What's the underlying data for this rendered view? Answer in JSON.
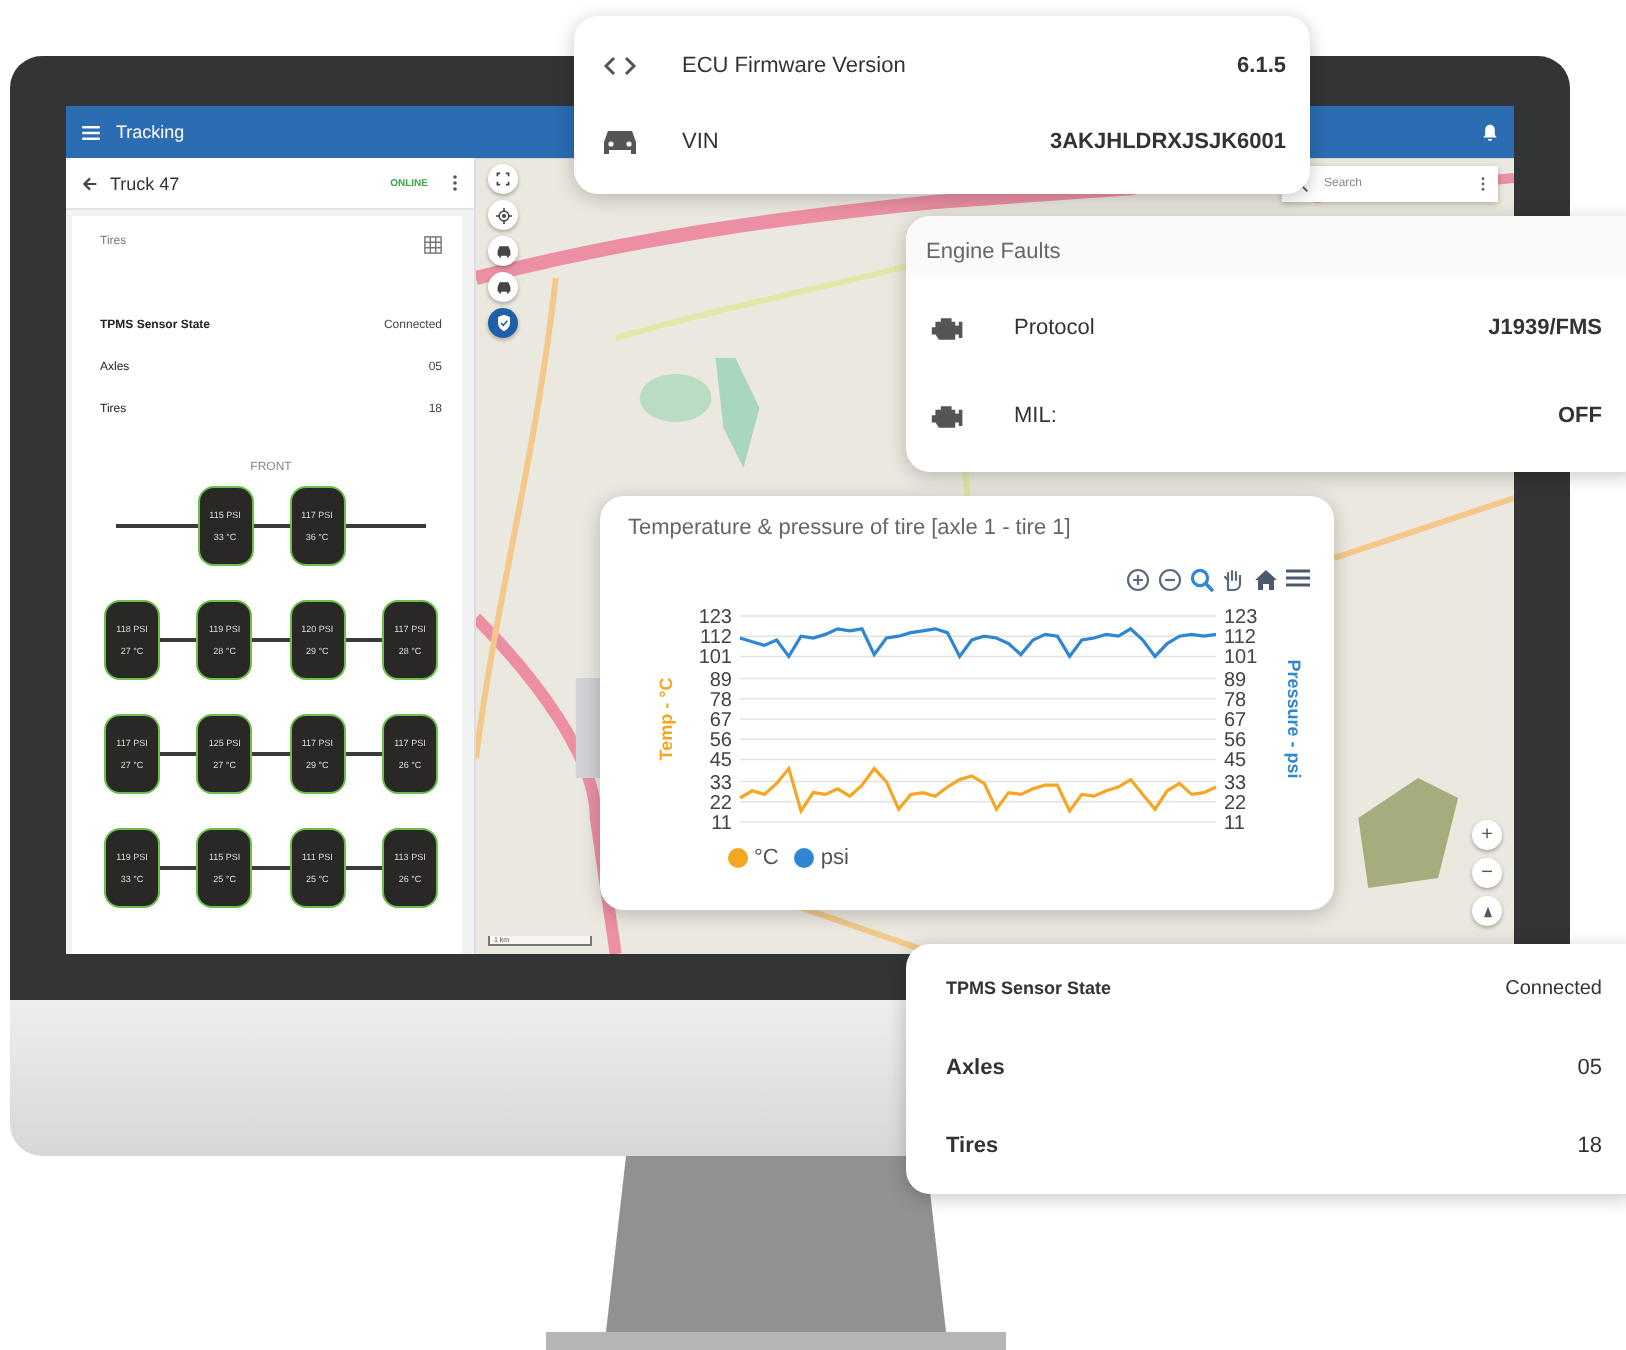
{
  "app_header": {
    "title": "Tracking"
  },
  "vehicle_panel": {
    "title": "Truck 47",
    "status": "ONLINE",
    "section_title": "Tires",
    "details": [
      {
        "label": "TPMS Sensor State",
        "value": "Connected"
      },
      {
        "label": "Axles",
        "value": "05"
      },
      {
        "label": "Tires",
        "value": "18"
      }
    ],
    "axle_label": "FRONT",
    "axles": [
      {
        "tires": [
          {
            "pressure": "115 PSI",
            "temperature": "33 °C"
          },
          {
            "pressure": "117 PSI",
            "temperature": "36 °C"
          }
        ]
      },
      {
        "tires": [
          {
            "pressure": "118 PSI",
            "temperature": "27 °C"
          },
          {
            "pressure": "119 PSI",
            "temperature": "28 °C"
          },
          {
            "pressure": "120 PSI",
            "temperature": "29 °C"
          },
          {
            "pressure": "117 PSI",
            "temperature": "28 °C"
          }
        ]
      },
      {
        "tires": [
          {
            "pressure": "117 PSI",
            "temperature": "27 °C"
          },
          {
            "pressure": "125 PSI",
            "temperature": "27 °C"
          },
          {
            "pressure": "117 PSI",
            "temperature": "29 °C"
          },
          {
            "pressure": "117 PSI",
            "temperature": "26 °C"
          }
        ]
      },
      {
        "tires": [
          {
            "pressure": "119 PSI",
            "temperature": "33 °C"
          },
          {
            "pressure": "115 PSI",
            "temperature": "25 °C"
          },
          {
            "pressure": "111 PSI",
            "temperature": "25 °C"
          },
          {
            "pressure": "113 PSI",
            "temperature": "26 °C"
          }
        ]
      }
    ]
  },
  "map": {
    "toolbar": [
      {
        "kind": "fullscreen",
        "selected": false
      },
      {
        "kind": "locate",
        "selected": false
      },
      {
        "kind": "fleet",
        "selected": false
      },
      {
        "kind": "car",
        "selected": false
      },
      {
        "kind": "shield",
        "selected": true
      }
    ],
    "search": {
      "placeholder": "Search"
    },
    "zoom_controls": [
      "+",
      "−"
    ],
    "scale": "1 km"
  },
  "firmware_card": {
    "rows": [
      {
        "kind": "code",
        "label": "ECU Firmware Version",
        "value": "6.1.5"
      },
      {
        "kind": "car",
        "label": "VIN",
        "value": "3AKJHLDRXJSJK6001"
      }
    ]
  },
  "engine_faults_card": {
    "title": "Engine Faults",
    "rows": [
      {
        "label": "Protocol",
        "value": "J1939/FMS"
      },
      {
        "label": "MIL:",
        "value": "OFF"
      }
    ]
  },
  "chart_card": {
    "right_axis": {
      "title": "Pressure - psi",
      "ticks": [
        "123",
        "112",
        "101",
        "89",
        "78",
        "67",
        "56",
        "45",
        "33",
        "22",
        "11"
      ]
    },
    "chart_data": {
      "type": "line",
      "title": "Temperature & pressure of tire [axle 1 - tire 1]",
      "ylabel": "Temp - °C",
      "grid": true,
      "categories": [
        null,
        null,
        null,
        null,
        null,
        null,
        null,
        null,
        null,
        null,
        null,
        null,
        null,
        null,
        null,
        null,
        null,
        null,
        null,
        null,
        null,
        null,
        null,
        null,
        null,
        null,
        null,
        null,
        null,
        null,
        null,
        null,
        null,
        null,
        null,
        null,
        null,
        null,
        null,
        null
      ],
      "ylim": [
        11,
        123
      ],
      "yticks": [
        11,
        22,
        33,
        45,
        56,
        67,
        78,
        89,
        101,
        112,
        123
      ],
      "series": [
        {
          "name": "°C",
          "color": "#f5a623",
          "values": [
            24,
            28,
            26,
            32,
            40,
            17,
            27,
            26,
            29,
            25,
            31,
            40,
            33,
            18,
            26,
            27,
            25,
            30,
            34,
            36,
            32,
            18,
            27,
            26,
            29,
            31,
            31,
            17,
            26,
            25,
            28,
            30,
            34,
            26,
            18,
            28,
            32,
            26,
            27,
            30
          ]
        },
        {
          "name": "psi",
          "color": "#2f86d1",
          "values": [
            111,
            109,
            107,
            110,
            101,
            112,
            111,
            113,
            116,
            115,
            116,
            102,
            111,
            112,
            114,
            115,
            116,
            114,
            101,
            110,
            112,
            111,
            108,
            102,
            110,
            113,
            112,
            101,
            110,
            111,
            113,
            112,
            116,
            110,
            101,
            108,
            112,
            113,
            112,
            113
          ]
        }
      ]
    }
  },
  "tpms_card": {
    "rows": [
      {
        "label": "TPMS Sensor State",
        "value": "Connected"
      },
      {
        "label": "Axles",
        "value": "05"
      },
      {
        "label": "Tires",
        "value": "18"
      }
    ]
  }
}
